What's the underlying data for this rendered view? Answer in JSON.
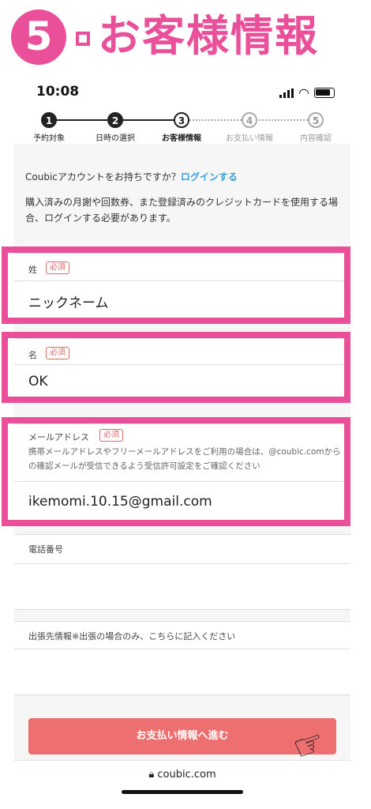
{
  "banner": {
    "step_number": "5",
    "title": "お客様情報"
  },
  "status_bar": {
    "time": "10:08"
  },
  "stepper": [
    {
      "num": "1",
      "label": "予約対象",
      "state": "done"
    },
    {
      "num": "2",
      "label": "日時の選択",
      "state": "done"
    },
    {
      "num": "3",
      "label": "お客様情報",
      "state": "current"
    },
    {
      "num": "4",
      "label": "お支払い情報",
      "state": "todo"
    },
    {
      "num": "5",
      "label": "内容確認",
      "state": "todo"
    }
  ],
  "intro": {
    "question": "Coubicアカウントをお持ちですか？",
    "login_link": "ログインする",
    "note": "購入済みの月謝や回数券、また登録済みのクレジットカードを使用する場合、ログインする必要があります。"
  },
  "form": {
    "required_badge": "必須",
    "last_name": {
      "label": "姓",
      "value": "ニックネーム"
    },
    "first_name": {
      "label": "名",
      "value": "OK"
    },
    "email": {
      "label": "メールアドレス",
      "help": "携帯メールアドレスやフリーメールアドレスをご利用の場合は、@coubic.comからの確認メールが受信できるよう受信許可設定をご確認ください",
      "value": "ikemomi.10.15@gmail.com"
    },
    "phone": {
      "label": "電話番号",
      "value": ""
    },
    "trip_info": {
      "label": "出張先情報※出張の場合のみ、こちらに記入ください",
      "value": ""
    }
  },
  "submit_button": "お支払い情報へ進む",
  "url": "coubic.com",
  "colors": {
    "highlight": "#ea4f9a",
    "button": "#ee6f6f",
    "link": "#3aa0d8"
  }
}
